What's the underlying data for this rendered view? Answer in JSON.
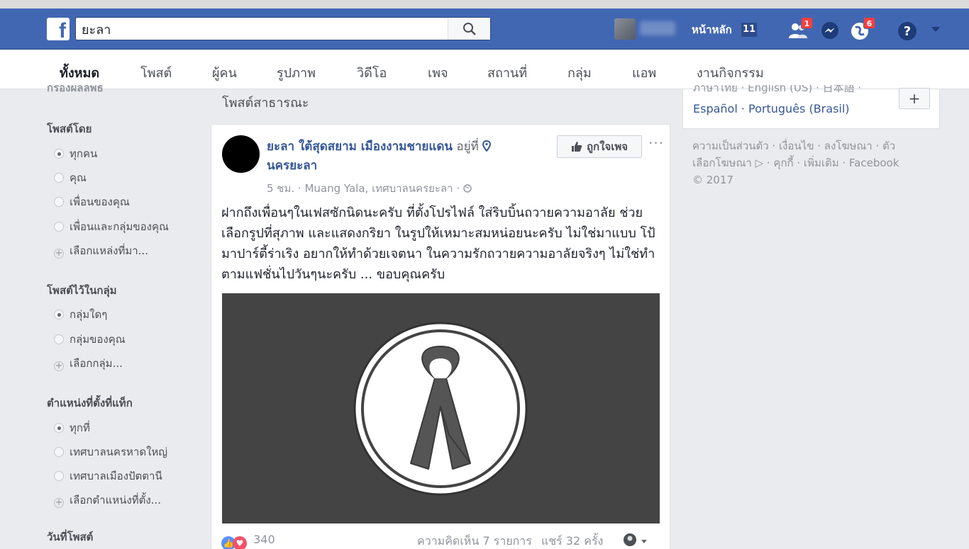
{
  "header": {
    "logo": "f",
    "search_value": "ยะลา",
    "home_label": "หน้าหลัก",
    "home_count": "11",
    "friend_requests_count": "1",
    "notifications_count": "6"
  },
  "tabs": [
    {
      "label": "ทั้งหมด",
      "active": true
    },
    {
      "label": "โพสต์"
    },
    {
      "label": "ผู้คน"
    },
    {
      "label": "รูปภาพ"
    },
    {
      "label": "วิดีโอ"
    },
    {
      "label": "เพจ"
    },
    {
      "label": "สถานที่"
    },
    {
      "label": "กลุ่ม"
    },
    {
      "label": "แอพ"
    },
    {
      "label": "งานกิจกรรม"
    }
  ],
  "filters": {
    "top_cut": "กรองผลลัพธ์",
    "posted_by": {
      "heading": "โพสต์โดย",
      "options": [
        "ทุกคน",
        "คุณ",
        "เพื่อนของคุณ",
        "เพื่อนและกลุ่มของคุณ"
      ],
      "choose": "เลือกแหล่งที่มา..."
    },
    "posted_in_group": {
      "heading": "โพสต์ไว้ในกลุ่ม",
      "options": [
        "กลุ่มใดๆ",
        "กลุ่มของคุณ"
      ],
      "choose": "เลือกกลุ่ม..."
    },
    "tagged_location": {
      "heading": "ตำแหน่งที่ตั้งที่แท็ก",
      "options": [
        "ทุกที่",
        "เทศบาลนครหาดใหญ่",
        "เทศบาลเมืองปัตตานี"
      ],
      "choose": "เลือกตำแหน่งที่ตั้ง..."
    },
    "date_posted": {
      "heading": "วันที่โพสต์"
    }
  },
  "main": {
    "section_title": "โพสต์สาธารณะ",
    "post": {
      "page_name": "ยะลา ใต้สุดสยาม เมืองงามชายแดน",
      "is_at": "อยู่ที่",
      "location": "นครยะลา",
      "meta": "5 ชม. · Muang Yala, เทศบาลนครยะลา ·",
      "like_page_label": "ถูกใจเพจ",
      "text": "ฝากถึงเพื่อนๆในเฟสซักนิดนะครับ ที่ตั้งโปรไฟล์ ใส่ริบบิ้นถวายความอาลัย ช่วยเลือกรูปที่สุภาพ และแสดงกริยา ในรูปให้เหมาะสมหน่อยนะครับ ไม่ใช่มาแบบ โป้ มาปาร์ตี้ร่าเริง อยากให้ทำด้วยเจตนา ในความรักถวายความอาลัยจริงๆ ไม่ใช่ทำตามแฟชั่นไปวันๆนะครับ ... ขอบคุณครับ",
      "reactions_count": "340",
      "comments": "ความคิดเห็น 7 รายการ",
      "shares": "แชร์ 32 ครั้ง"
    }
  },
  "right": {
    "lang_cut": "ภาษาไทย · English (US) · 日本語 ·",
    "lang_row2": "Español · Português (Brasil)",
    "lang_add": "+",
    "footer": "ความเป็นส่วนตัว · เงื่อนไข · ลงโฆษณา · ตัวเลือกโฆษณา ▷ · คุกกี้ · เพิ่มเติม · Facebook © 2017"
  },
  "colors": {
    "brand_blue": "#4267b2",
    "link_blue": "#365899",
    "badge_red": "#fa3e3e",
    "image_bg": "#444444"
  }
}
